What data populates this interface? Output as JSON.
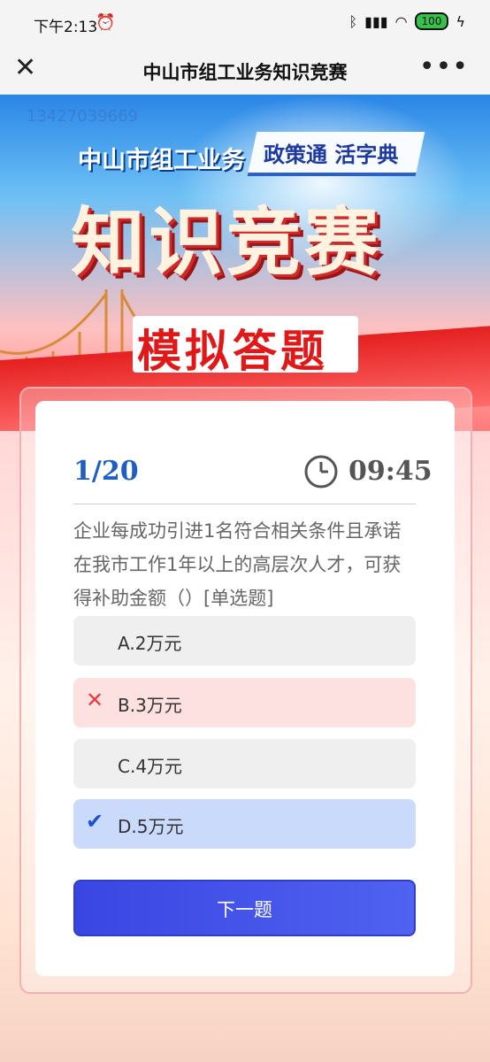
{
  "status_bar": {
    "time": "下午2:13",
    "battery": "100"
  },
  "title_bar": {
    "title": "中山市组工业务知识竞赛"
  },
  "banner": {
    "phone": "13427039669",
    "heading_small": "中山市组工业务",
    "tag": "政策通 活字典",
    "heading_large": "知识竞赛",
    "heading_sub": "模拟答题"
  },
  "quiz": {
    "progress": "1/20",
    "timer": "09:45",
    "question": "企业每成功引进1名符合相关条件且承诺在我市工作1年以上的高层次人才，可获得补助金额（）[单选题]",
    "options": [
      {
        "label": "A.2万元",
        "state": "normal"
      },
      {
        "label": "B.3万元",
        "state": "wrong"
      },
      {
        "label": "C.4万元",
        "state": "normal"
      },
      {
        "label": "D.5万元",
        "state": "correct"
      }
    ],
    "next_label": "下一题"
  },
  "colors": {
    "accent": "#1f5ec4",
    "wrong_bg": "#fde0e0",
    "correct_bg": "#c9dafb",
    "button": "#3a46e2"
  },
  "icons": {
    "close": "close-icon",
    "more": "more-icon",
    "clock": "clock-icon",
    "wrong": "cross-icon",
    "correct": "check-icon"
  }
}
